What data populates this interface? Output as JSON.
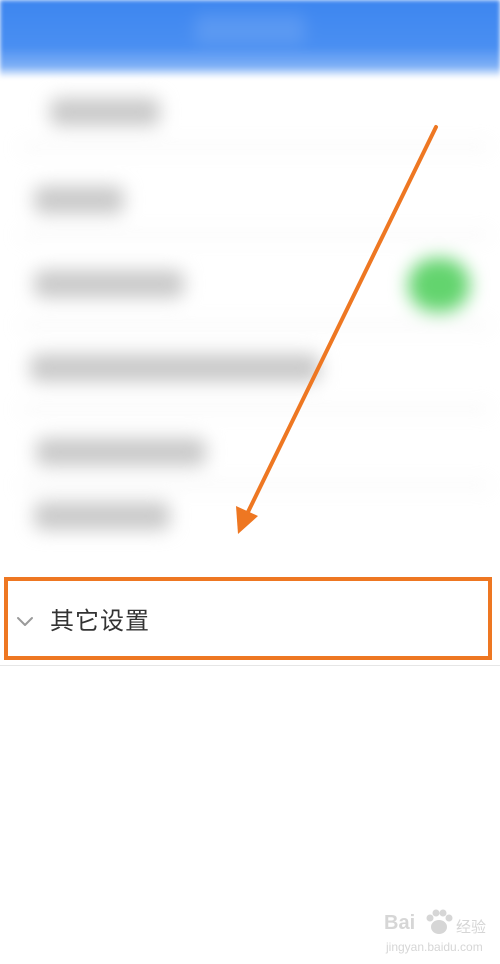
{
  "section": {
    "label": "其它设置",
    "icon": "chevron-down-icon"
  },
  "annotation": {
    "box_color": "#ee7722",
    "arrow_color": "#ee7722"
  },
  "header": {
    "color": "#3d86f0"
  },
  "watermark": {
    "brand": "Bai",
    "suffix": "经验",
    "url": "jingyan.baidu.com"
  }
}
